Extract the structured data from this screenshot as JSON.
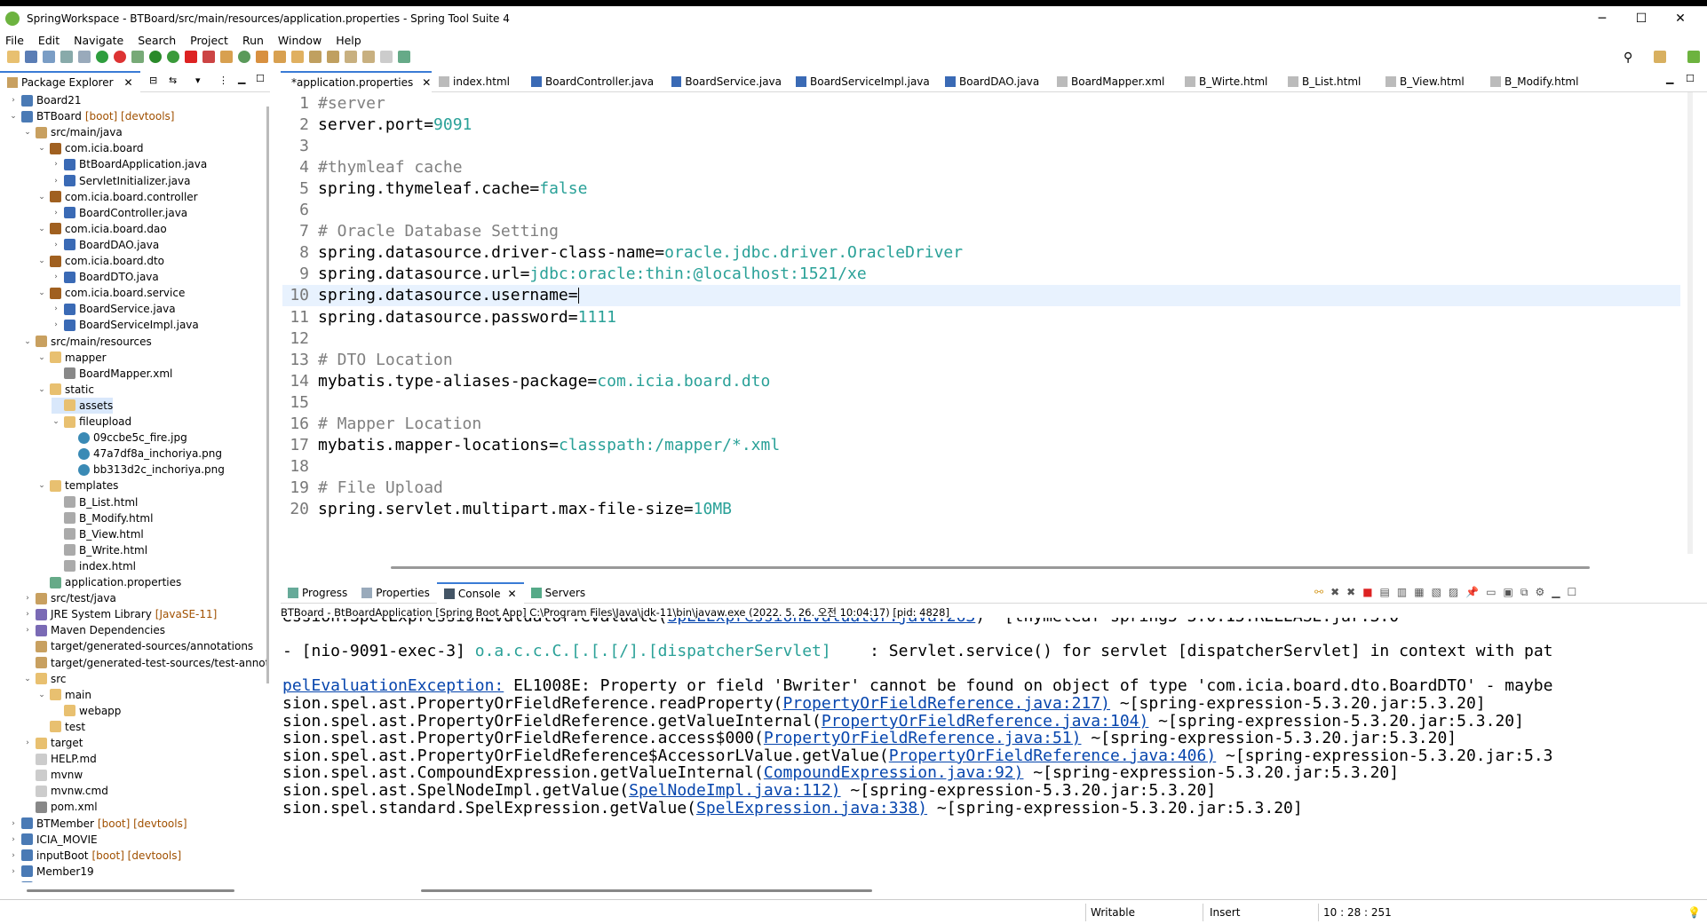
{
  "window": {
    "title": "SpringWorkspace - BTBoard/src/main/resources/application.properties - Spring Tool Suite 4",
    "minimize": "─",
    "maximize": "☐",
    "close": "✕"
  },
  "menu": [
    "File",
    "Edit",
    "Navigate",
    "Search",
    "Project",
    "Run",
    "Window",
    "Help"
  ],
  "explorer": {
    "tab_label": "Package Explorer",
    "rows": [
      {
        "level": 0,
        "arrow": "›",
        "icon": "project",
        "label": "Board21",
        "deco": ""
      },
      {
        "level": 0,
        "arrow": "⌄",
        "icon": "project",
        "label": "BTBoard",
        "deco": "[boot] [devtools]"
      },
      {
        "level": 1,
        "arrow": "⌄",
        "icon": "srcfolder",
        "label": "src/main/java",
        "deco": ""
      },
      {
        "level": 2,
        "arrow": "⌄",
        "icon": "package",
        "label": "com.icia.board",
        "deco": ""
      },
      {
        "level": 3,
        "arrow": "›",
        "icon": "java",
        "label": "BtBoardApplication.java",
        "deco": ""
      },
      {
        "level": 3,
        "arrow": "›",
        "icon": "java",
        "label": "ServletInitializer.java",
        "deco": ""
      },
      {
        "level": 2,
        "arrow": "⌄",
        "icon": "package",
        "label": "com.icia.board.controller",
        "deco": ""
      },
      {
        "level": 3,
        "arrow": "›",
        "icon": "java",
        "label": "BoardController.java",
        "deco": ""
      },
      {
        "level": 2,
        "arrow": "⌄",
        "icon": "package",
        "label": "com.icia.board.dao",
        "deco": ""
      },
      {
        "level": 3,
        "arrow": "›",
        "icon": "java",
        "label": "BoardDAO.java",
        "deco": ""
      },
      {
        "level": 2,
        "arrow": "⌄",
        "icon": "package",
        "label": "com.icia.board.dto",
        "deco": ""
      },
      {
        "level": 3,
        "arrow": "›",
        "icon": "java",
        "label": "BoardDTO.java",
        "deco": ""
      },
      {
        "level": 2,
        "arrow": "⌄",
        "icon": "package",
        "label": "com.icia.board.service",
        "deco": ""
      },
      {
        "level": 3,
        "arrow": "›",
        "icon": "java",
        "label": "BoardService.java",
        "deco": ""
      },
      {
        "level": 3,
        "arrow": "›",
        "icon": "java",
        "label": "BoardServiceImpl.java",
        "deco": ""
      },
      {
        "level": 1,
        "arrow": "⌄",
        "icon": "srcfolder",
        "label": "src/main/resources",
        "deco": ""
      },
      {
        "level": 2,
        "arrow": "⌄",
        "icon": "folder",
        "label": "mapper",
        "deco": ""
      },
      {
        "level": 3,
        "arrow": "",
        "icon": "xml",
        "label": "BoardMapper.xml",
        "deco": ""
      },
      {
        "level": 2,
        "arrow": "⌄",
        "icon": "folder",
        "label": "static",
        "deco": ""
      },
      {
        "level": 3,
        "arrow": "",
        "icon": "folder",
        "label": "assets",
        "deco": "",
        "selected": true
      },
      {
        "level": 3,
        "arrow": "⌄",
        "icon": "folder",
        "label": "fileupload",
        "deco": ""
      },
      {
        "level": 4,
        "arrow": "",
        "icon": "image",
        "label": "09ccbe5c_fire.jpg",
        "deco": ""
      },
      {
        "level": 4,
        "arrow": "",
        "icon": "image",
        "label": "47a7df8a_inchoriya.png",
        "deco": ""
      },
      {
        "level": 4,
        "arrow": "",
        "icon": "image",
        "label": "bb313d2c_inchoriya.png",
        "deco": ""
      },
      {
        "level": 2,
        "arrow": "⌄",
        "icon": "folder",
        "label": "templates",
        "deco": ""
      },
      {
        "level": 3,
        "arrow": "",
        "icon": "html",
        "label": "B_List.html",
        "deco": ""
      },
      {
        "level": 3,
        "arrow": "",
        "icon": "html",
        "label": "B_Modify.html",
        "deco": ""
      },
      {
        "level": 3,
        "arrow": "",
        "icon": "html",
        "label": "B_View.html",
        "deco": ""
      },
      {
        "level": 3,
        "arrow": "",
        "icon": "html",
        "label": "B_Write.html",
        "deco": ""
      },
      {
        "level": 3,
        "arrow": "",
        "icon": "html",
        "label": "index.html",
        "deco": ""
      },
      {
        "level": 2,
        "arrow": "",
        "icon": "props",
        "label": "application.properties",
        "deco": ""
      },
      {
        "level": 1,
        "arrow": "›",
        "icon": "srcfolder",
        "label": "src/test/java",
        "deco": ""
      },
      {
        "level": 1,
        "arrow": "›",
        "icon": "library",
        "label": "JRE System Library",
        "deco": "[JavaSE-11]"
      },
      {
        "level": 1,
        "arrow": "›",
        "icon": "library",
        "label": "Maven Dependencies",
        "deco": ""
      },
      {
        "level": 1,
        "arrow": "",
        "icon": "srcfolder",
        "label": "target/generated-sources/annotations",
        "deco": ""
      },
      {
        "level": 1,
        "arrow": "",
        "icon": "srcfolder",
        "label": "target/generated-test-sources/test-annotatic",
        "deco": ""
      },
      {
        "level": 1,
        "arrow": "⌄",
        "icon": "folder",
        "label": "src",
        "deco": ""
      },
      {
        "level": 2,
        "arrow": "⌄",
        "icon": "folder",
        "label": "main",
        "deco": ""
      },
      {
        "level": 3,
        "arrow": "",
        "icon": "folder",
        "label": "webapp",
        "deco": ""
      },
      {
        "level": 2,
        "arrow": "",
        "icon": "folder",
        "label": "test",
        "deco": ""
      },
      {
        "level": 1,
        "arrow": "›",
        "icon": "folder",
        "label": "target",
        "deco": ""
      },
      {
        "level": 1,
        "arrow": "",
        "icon": "file",
        "label": "HELP.md",
        "deco": ""
      },
      {
        "level": 1,
        "arrow": "",
        "icon": "file",
        "label": "mvnw",
        "deco": ""
      },
      {
        "level": 1,
        "arrow": "",
        "icon": "file",
        "label": "mvnw.cmd",
        "deco": ""
      },
      {
        "level": 1,
        "arrow": "",
        "icon": "xml",
        "label": "pom.xml",
        "deco": ""
      },
      {
        "level": 0,
        "arrow": "›",
        "icon": "project",
        "label": "BTMember",
        "deco": "[boot] [devtools]"
      },
      {
        "level": 0,
        "arrow": "›",
        "icon": "project",
        "label": "ICIA_MOVIE",
        "deco": ""
      },
      {
        "level": 0,
        "arrow": "›",
        "icon": "project",
        "label": "inputBoot",
        "deco": "[boot] [devtools]"
      },
      {
        "level": 0,
        "arrow": "›",
        "icon": "project",
        "label": "Member19",
        "deco": ""
      },
      {
        "level": 0,
        "arrow": "›",
        "icon": "project",
        "label": "Memberinterface",
        "deco": ""
      }
    ]
  },
  "editor_tabs": [
    {
      "label": "*application.properties",
      "active": true,
      "closable": true
    },
    {
      "label": "index.html"
    },
    {
      "label": "BoardController.java"
    },
    {
      "label": "BoardService.java"
    },
    {
      "label": "BoardServiceImpl.java"
    },
    {
      "label": "BoardDAO.java"
    },
    {
      "label": "BoardMapper.xml"
    },
    {
      "label": "B_Wirte.html"
    },
    {
      "label": "B_List.html"
    },
    {
      "label": "B_View.html"
    },
    {
      "label": "B_Modify.html"
    }
  ],
  "editor_lines": [
    {
      "n": "1",
      "parts": [
        {
          "t": "#server",
          "c": "com"
        }
      ]
    },
    {
      "n": "2",
      "parts": [
        {
          "t": "server.port=",
          "c": "key"
        },
        {
          "t": "9091",
          "c": "val"
        }
      ]
    },
    {
      "n": "3",
      "parts": []
    },
    {
      "n": "4",
      "parts": [
        {
          "t": "#thymleaf cache",
          "c": "com"
        }
      ]
    },
    {
      "n": "5",
      "parts": [
        {
          "t": "spring.thymeleaf.cache=",
          "c": "key"
        },
        {
          "t": "false",
          "c": "val"
        }
      ]
    },
    {
      "n": "6",
      "parts": []
    },
    {
      "n": "7",
      "parts": [
        {
          "t": "# Oracle Database Setting",
          "c": "com"
        }
      ]
    },
    {
      "n": "8",
      "parts": [
        {
          "t": "spring.datasource.driver-class-name=",
          "c": "key"
        },
        {
          "t": "oracle.jdbc.driver.OracleDriver",
          "c": "val"
        }
      ]
    },
    {
      "n": "9",
      "parts": [
        {
          "t": "spring.datasource.url=",
          "c": "key"
        },
        {
          "t": "jdbc:oracle:thin:@localhost:1521/xe",
          "c": "val"
        }
      ]
    },
    {
      "n": "10",
      "parts": [
        {
          "t": "spring.datasource.username=",
          "c": "key"
        }
      ],
      "current": true
    },
    {
      "n": "11",
      "parts": [
        {
          "t": "spring.datasource.password=",
          "c": "key"
        },
        {
          "t": "1111",
          "c": "val"
        }
      ]
    },
    {
      "n": "12",
      "parts": []
    },
    {
      "n": "13",
      "parts": [
        {
          "t": "# DTO Location",
          "c": "com"
        }
      ]
    },
    {
      "n": "14",
      "parts": [
        {
          "t": "mybatis.type-aliases-package=",
          "c": "key"
        },
        {
          "t": "com.icia.board.dto",
          "c": "val"
        }
      ]
    },
    {
      "n": "15",
      "parts": []
    },
    {
      "n": "16",
      "parts": [
        {
          "t": "# Mapper Location",
          "c": "com"
        }
      ]
    },
    {
      "n": "17",
      "parts": [
        {
          "t": "mybatis.mapper-locations=",
          "c": "key"
        },
        {
          "t": "classpath:/mapper/*.xml",
          "c": "val"
        }
      ]
    },
    {
      "n": "18",
      "parts": []
    },
    {
      "n": "19",
      "parts": [
        {
          "t": "# File Upload",
          "c": "com"
        }
      ]
    },
    {
      "n": "20",
      "parts": [
        {
          "t": "spring.servlet.multipart.max-file-size=",
          "c": "key"
        },
        {
          "t": "10MB",
          "c": "val"
        }
      ]
    }
  ],
  "bottom_tabs": [
    {
      "label": "Progress",
      "icon": "progress-icon"
    },
    {
      "label": "Properties",
      "icon": "properties-icon"
    },
    {
      "label": "Console",
      "icon": "console-icon",
      "active": true,
      "closable": true
    },
    {
      "label": "Servers",
      "icon": "servers-icon"
    }
  ],
  "console": {
    "header": "BTBoard - BtBoardApplication [Spring Boot App] C:\\Program Files\\Java\\jdk-11\\bin\\javaw.exe  (2022. 5. 26. 오전 10:04:17) [pid: 4828]",
    "lines": [
      {
        "parts": [
          {
            "t": "ession.SpelExpressionEvaluator.evaluate("
          },
          {
            "t": "SpELExpressionEvaluator.java:263",
            "link": true
          },
          {
            "t": ") ~[thymeleaf-spring5-3.0.15.RELEASE.jar:3.0"
          }
        ]
      },
      {
        "parts": []
      },
      {
        "parts": [
          {
            "t": "- [nio-9091-exec-3] "
          },
          {
            "t": "o.a.c.c.C.[.[.[/].[dispatcherServlet]",
            "cls": "teal"
          },
          {
            "t": "    : Servlet.service() for servlet [dispatcherServlet] in context with pat"
          }
        ]
      },
      {
        "parts": []
      },
      {
        "parts": [
          {
            "t": "pelEvaluationException:",
            "link": true
          },
          {
            "t": " EL1008E: Property or field 'Bwriter' cannot be found on object of type 'com.icia.board.dto.BoardDTO' - maybe"
          }
        ]
      },
      {
        "parts": [
          {
            "t": "sion.spel.ast.PropertyOrFieldReference.readProperty("
          },
          {
            "t": "PropertyOrFieldReference.java:217)",
            "link": true
          },
          {
            "t": " ~[spring-expression-5.3.20.jar:5.3.20]"
          }
        ]
      },
      {
        "parts": [
          {
            "t": "sion.spel.ast.PropertyOrFieldReference.getValueInternal("
          },
          {
            "t": "PropertyOrFieldReference.java:104)",
            "link": true
          },
          {
            "t": " ~[spring-expression-5.3.20.jar:5.3.20]"
          }
        ]
      },
      {
        "parts": [
          {
            "t": "sion.spel.ast.PropertyOrFieldReference.access$000("
          },
          {
            "t": "PropertyOrFieldReference.java:51)",
            "link": true
          },
          {
            "t": " ~[spring-expression-5.3.20.jar:5.3.20]"
          }
        ]
      },
      {
        "parts": [
          {
            "t": "sion.spel.ast.PropertyOrFieldReference$AccessorLValue.getValue("
          },
          {
            "t": "PropertyOrFieldReference.java:406)",
            "link": true
          },
          {
            "t": " ~[spring-expression-5.3.20.jar:5.3"
          }
        ]
      },
      {
        "parts": [
          {
            "t": "sion.spel.ast.CompoundExpression.getValueInternal("
          },
          {
            "t": "CompoundExpression.java:92)",
            "link": true
          },
          {
            "t": " ~[spring-expression-5.3.20.jar:5.3.20]"
          }
        ]
      },
      {
        "parts": [
          {
            "t": "sion.spel.ast.SpelNodeImpl.getValue("
          },
          {
            "t": "SpelNodeImpl.java:112)",
            "link": true
          },
          {
            "t": " ~[spring-expression-5.3.20.jar:5.3.20]"
          }
        ]
      },
      {
        "parts": [
          {
            "t": "sion.spel.standard.SpelExpression.getValue("
          },
          {
            "t": "SpelExpression.java:338)",
            "link": true
          },
          {
            "t": " ~[spring-expression-5.3.20.jar:5.3.20]"
          }
        ]
      }
    ]
  },
  "status": {
    "writable": "Writable",
    "mode": "Insert",
    "position": "10 : 28 : 251"
  },
  "colors": {
    "accent": "#3a7bd5",
    "value": "#2aa198",
    "comment": "#808080",
    "link": "#0645ad",
    "current_line": "#e8f2fe"
  }
}
